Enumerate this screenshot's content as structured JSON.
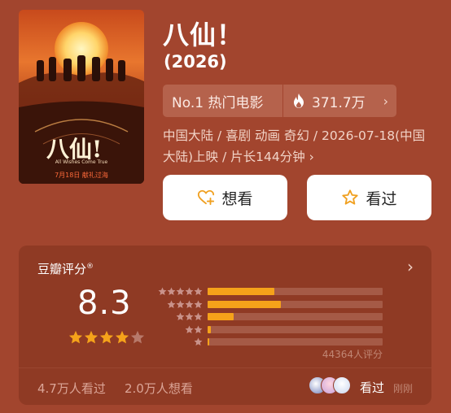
{
  "movie": {
    "title": "八仙！",
    "year": "(2026)",
    "rank_label": "No.1 热门电影",
    "heat_value": "371.7万",
    "meta": "中国大陆 / 喜剧 动画 奇幻 / 2026-07-18(中国大陆)上映 / 片长144分钟 ›"
  },
  "poster": {
    "title_art": "八仙!",
    "subtitle": "All Wishes Come True",
    "release_line": "7月18日 献礼过海"
  },
  "actions": {
    "wish_label": "想看",
    "seen_label": "看过"
  },
  "rating": {
    "section_title": "豆瓣评分",
    "section_mark": "®",
    "score": "8.3",
    "stars_filled": 4,
    "stars_total": 5,
    "distribution": [
      {
        "stars": 5,
        "fraction": 0.38
      },
      {
        "stars": 4,
        "fraction": 0.42
      },
      {
        "stars": 3,
        "fraction": 0.15
      },
      {
        "stars": 2,
        "fraction": 0.02
      },
      {
        "stars": 1,
        "fraction": 0.01
      }
    ],
    "count_text": "44364人评分",
    "seen_count": "4.7万人看过",
    "wish_count": "2.0万人想看",
    "friends_label": "看过",
    "friends_time": "刚刚"
  },
  "colors": {
    "background": "#a2452e",
    "card": "#8f3a24",
    "star": "#f5a21a",
    "accent": "#f0a020"
  },
  "icons": {
    "heat": "fire-icon",
    "wish": "heart-plus-icon",
    "seen": "star-outline-icon"
  }
}
